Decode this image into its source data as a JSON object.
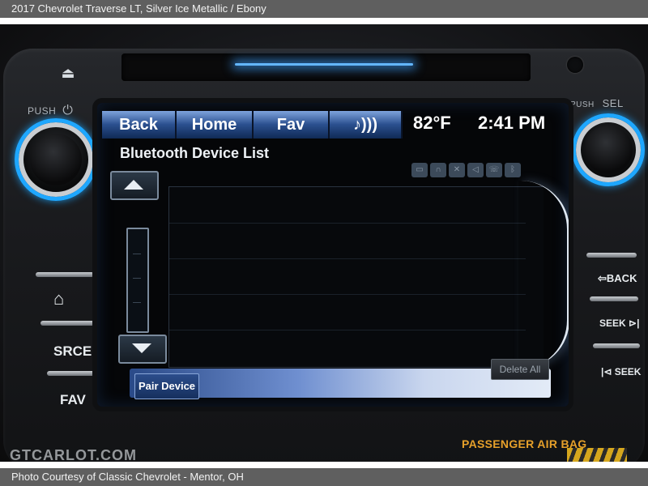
{
  "header": {
    "caption": "2017 Chevrolet Traverse LT,  Silver Ice Metallic / Ebony"
  },
  "footer": {
    "caption": "Photo Courtesy of Classic Chevrolet - Mentor, OH"
  },
  "console": {
    "push_power_label": "PUSH",
    "push_sel_label": "PUSH",
    "sel_label": "SEL",
    "left_buttons": {
      "source": "SRCE",
      "fav": "FAV"
    },
    "right_buttons": {
      "back": "BACK",
      "seek_forward": "SEEK",
      "seek_back": "SEEK"
    },
    "airbag_label": "PASSENGER  AIR BAG",
    "watermark": "GTCARLOT.COM"
  },
  "screen": {
    "tabs": [
      "Back",
      "Home",
      "Fav",
      ""
    ],
    "temperature": "82°F",
    "time": "2:41 PM",
    "title": "Bluetooth Device List",
    "pair_button": "Pair Device",
    "delete_button": "Delete All"
  },
  "colors": {
    "accent_blue": "#1ea7ff",
    "airbag_amber": "#e6a02a"
  }
}
